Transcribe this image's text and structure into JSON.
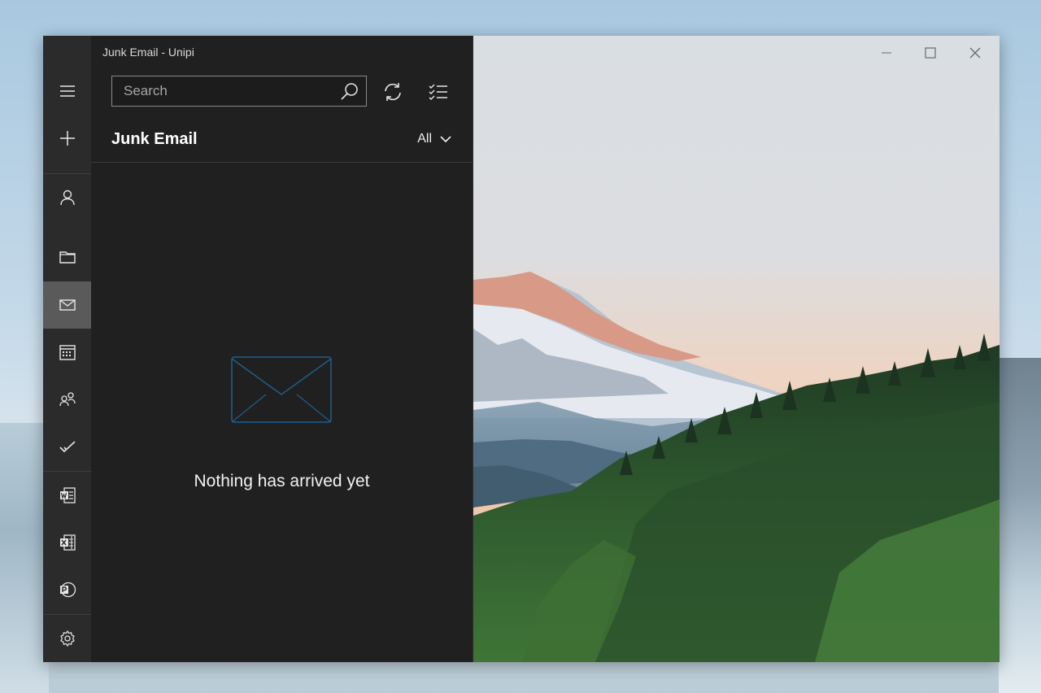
{
  "window": {
    "title": "Junk Email - Unipi"
  },
  "search": {
    "placeholder": "Search"
  },
  "folder": {
    "title": "Junk Email",
    "filter_label": "All"
  },
  "empty_state": {
    "message": "Nothing has arrived yet"
  },
  "nav": {
    "items": [
      {
        "icon": "hamburger-icon"
      },
      {
        "icon": "plus-icon"
      },
      {
        "icon": "person-icon"
      },
      {
        "icon": "folder-icon"
      },
      {
        "icon": "mail-icon",
        "active": true
      },
      {
        "icon": "calendar-icon"
      },
      {
        "icon": "people-icon"
      },
      {
        "icon": "todo-check-icon"
      },
      {
        "icon": "word-icon"
      },
      {
        "icon": "excel-icon"
      },
      {
        "icon": "powerpoint-icon"
      },
      {
        "icon": "settings-gear-icon"
      }
    ]
  },
  "colors": {
    "accent": "#1e5f8c",
    "rail_bg": "#2b2b2b",
    "pane_bg": "#202020",
    "active_bg": "#5a5a5a"
  }
}
